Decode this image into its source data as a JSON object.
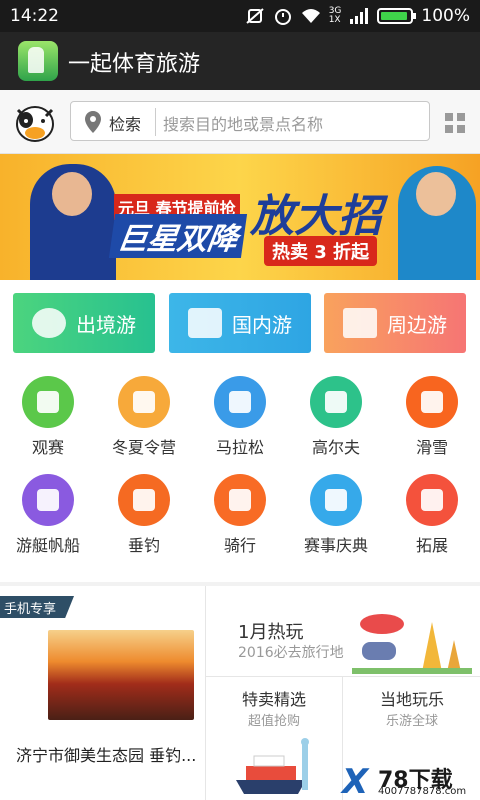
{
  "status_bar": {
    "time": "14:22",
    "network": "3G",
    "network_sub": "1X",
    "battery": "100%"
  },
  "app": {
    "title": "一起体育旅游"
  },
  "search": {
    "selector": "检索",
    "placeholder": "搜索目的地或景点名称"
  },
  "banner": {
    "line1": "元旦  春节提前抢",
    "line2": "巨星双降",
    "line3": "放大招",
    "line4": "热卖 3 折起"
  },
  "categories": [
    {
      "label": "出境游",
      "icon": "globe-icon"
    },
    {
      "label": "国内游",
      "icon": "pagoda-icon"
    },
    {
      "label": "周边游",
      "icon": "map-icon"
    }
  ],
  "activities": [
    {
      "label": "观赛",
      "icon": "spectators-icon",
      "color": "#5bc84a"
    },
    {
      "label": "冬夏令营",
      "icon": "backpack-icon",
      "color": "#f7a93a"
    },
    {
      "label": "马拉松",
      "icon": "ship-icon",
      "color": "#3a9be8"
    },
    {
      "label": "高尔夫",
      "icon": "golf-cart-icon",
      "color": "#2dc28a"
    },
    {
      "label": "滑雪",
      "icon": "ticket-icon",
      "color": "#f8651f"
    },
    {
      "label": "游艇帆船",
      "icon": "compass-icon",
      "color": "#8a5ae0"
    },
    {
      "label": "垂钓",
      "icon": "card-icon",
      "color": "#f56a22"
    },
    {
      "label": "骑行",
      "icon": "building-icon",
      "color": "#f86b25"
    },
    {
      "label": "赛事庆典",
      "icon": "wifi-icon",
      "color": "#36a9ea"
    },
    {
      "label": "拓展",
      "icon": "dollar-icon",
      "color": "#f4523c"
    }
  ],
  "featured": {
    "tag": "手机专享",
    "spot_title": "济宁市御美生态园 垂钓...",
    "hot_title": "1月热玩",
    "hot_sub": "2016必去旅行地",
    "deal_title": "特卖精选",
    "deal_sub": "超值抢购",
    "local_title": "当地玩乐",
    "local_sub": "乐游全球"
  },
  "watermark": {
    "brand": "78下载",
    "site": "4007787878.com"
  }
}
